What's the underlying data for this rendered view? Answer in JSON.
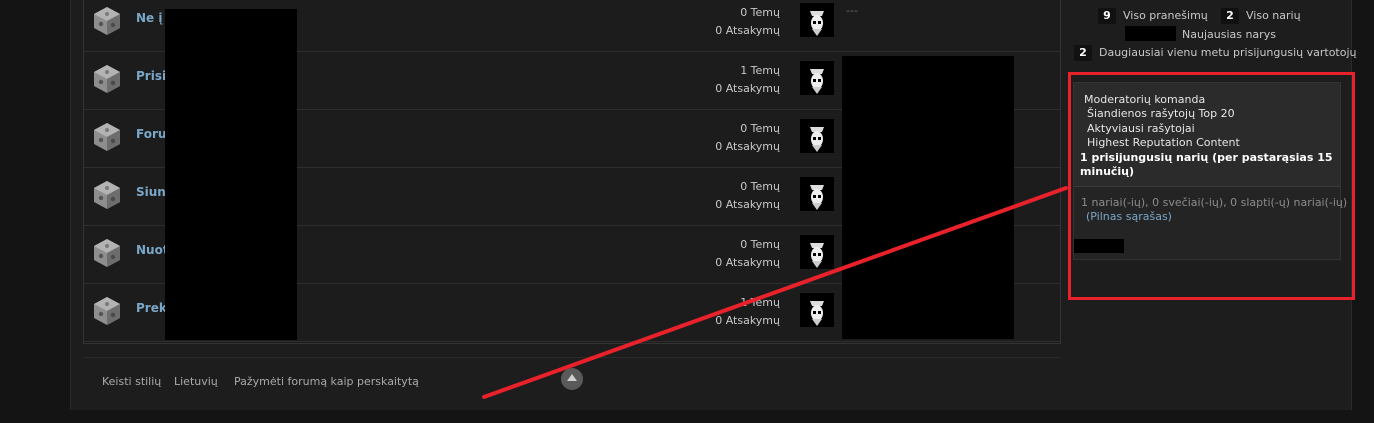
{
  "forums": [
    {
      "title": "Ne į t",
      "topics": "0 Temų",
      "replies": "0 Atsakymų",
      "last": "---"
    },
    {
      "title": "Prisis",
      "topics": "1 Temų",
      "replies": "0 Atsakymų",
      "last": ""
    },
    {
      "title": "Forum",
      "topics": "0 Temų",
      "replies": "0 Atsakymų",
      "last": ""
    },
    {
      "title": "Siunt",
      "topics": "0 Temų",
      "replies": "0 Atsakymų",
      "last": ""
    },
    {
      "title": "Nuot",
      "topics": "0 Temų",
      "replies": "0 Atsakymų",
      "last": ""
    },
    {
      "title": "Preky",
      "topics": "1 Temų",
      "replies": "0 Atsakymų",
      "last": ""
    }
  ],
  "footer": {
    "change_style": "Keisti stilių",
    "language": "Lietuvių",
    "mark_read": "Pažymėti forumą kaip perskaitytą"
  },
  "stats": {
    "posts_count": "9",
    "posts_label": "Viso pranešimų",
    "members_count": "2",
    "members_label": "Viso narių",
    "newest_member_label": "Naujausias narys",
    "max_online_count": "2",
    "max_online_label": "Daugiausiai vienu metu prisijungusių vartotojų"
  },
  "online": {
    "menu": [
      "Moderatorių komanda",
      "Šiandienos rašytojų Top 20",
      "Aktyviausi rašytojai",
      "Highest Reputation Content"
    ],
    "title": "1 prisijungusių narių (per pastarąsias 15 minučių)",
    "counts": "1 nariai(-ių), 0 svečiai(-ių), 0 slapti(-ų) nariai(-ių)",
    "full_list": "(Pilnas sąrašas)"
  },
  "colors": {
    "link": "#7aa6c8",
    "annotation_red": "#e8212b"
  }
}
